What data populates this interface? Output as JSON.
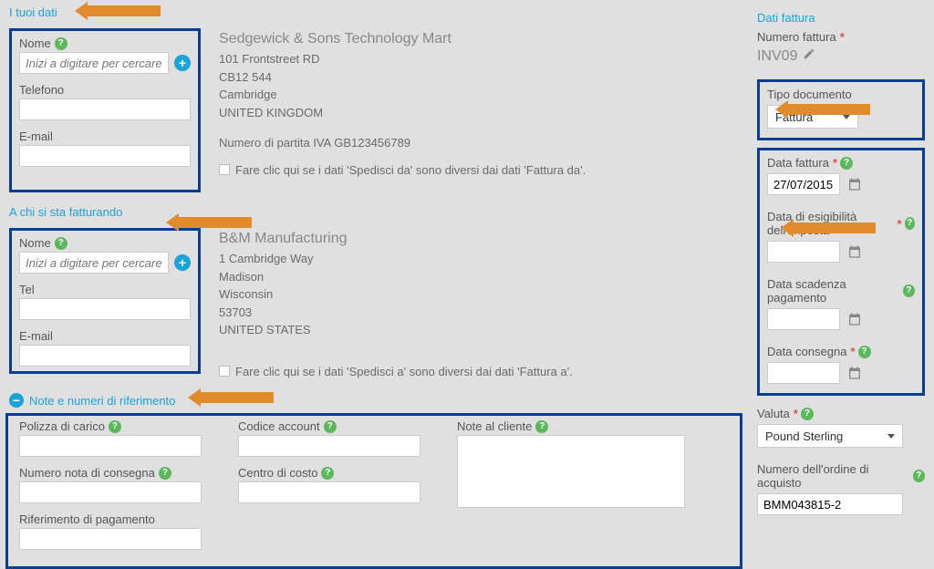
{
  "left": {
    "your_details": {
      "title": "I tuoi dati",
      "name_label": "Nome",
      "name_placeholder": "Inizi a digitare per cercare",
      "phone_label": "Telefono",
      "email_label": "E-mail",
      "company_name": "Sedgewick & Sons Technology Mart",
      "addr1": "101 Frontstreet RD",
      "addr2": "CB12 544",
      "city": "Cambridge",
      "country": "UNITED KINGDOM",
      "vat_label": "Numero di partita IVA GB123456789",
      "ship_from_diff": "Fare clic qui se i dati 'Spedisci da' sono diversi dai dati 'Fattura da'."
    },
    "bill_to": {
      "title": "A chi si sta fatturando",
      "name_label": "Nome",
      "name_placeholder": "Inizi a digitare per cercare",
      "phone_label": "Tel",
      "email_label": "E-mail",
      "company_name": "B&M Manufacturing",
      "addr1": "1 Cambridge Way",
      "city": "Madison",
      "region": "Wisconsin",
      "postcode": "53703",
      "country": "UNITED STATES",
      "ship_to_diff": "Fare clic qui se i dati 'Spedisci a' sono diversi dai dati 'Fattura a'."
    },
    "refs": {
      "title": "Note e numeri di riferimento",
      "bill_of_lading": "Polizza di carico",
      "delivery_note_number": "Numero nota di consegna",
      "payment_reference": "Riferimento di pagamento",
      "account_code": "Codice account",
      "cost_center": "Centro di costo",
      "customer_notes": "Note al cliente"
    }
  },
  "right": {
    "title": "Dati fattura",
    "invoice_number_label": "Numero fattura",
    "invoice_number": "INV09",
    "doc_type_label": "Tipo documento",
    "doc_type_value": "Fattura",
    "invoice_date_label": "Data fattura",
    "invoice_date_value": "27/07/2015",
    "tax_point_label": "Data di esigibilità dell'imposta",
    "due_date_label": "Data scadenza pagamento",
    "delivery_date_label": "Data consegna",
    "currency_label": "Valuta",
    "currency_value": "Pound Sterling",
    "po_label": "Numero dell'ordine di acquisto",
    "po_value": "BMM043815-2"
  }
}
